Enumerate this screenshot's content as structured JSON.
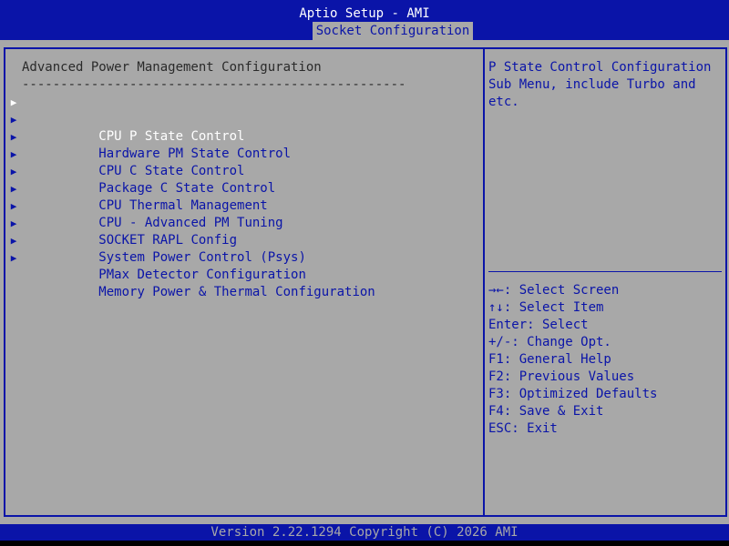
{
  "header": {
    "app_title": "Aptio Setup - AMI",
    "active_tab": "Socket Configuration"
  },
  "main": {
    "section_title": "Advanced Power Management Configuration",
    "divider": "--------------------------------------------------",
    "submenu_marker": "▶",
    "selected_index": 0,
    "items": [
      {
        "label": "CPU P State Control"
      },
      {
        "label": "Hardware PM State Control"
      },
      {
        "label": "CPU C State Control"
      },
      {
        "label": "Package C State Control"
      },
      {
        "label": "CPU Thermal Management"
      },
      {
        "label": "CPU - Advanced PM Tuning"
      },
      {
        "label": "SOCKET RAPL Config"
      },
      {
        "label": "System Power Control (Psys)"
      },
      {
        "label": "PMax Detector Configuration"
      },
      {
        "label": "Memory Power & Thermal Configuration"
      }
    ]
  },
  "help": {
    "text": "P State Control Configuration Sub Menu, include Turbo and etc.",
    "keys": [
      "→←: Select Screen",
      "↑↓: Select Item",
      "Enter: Select",
      "+/-: Change Opt.",
      "F1: General Help",
      "F2: Previous Values",
      "F3: Optimized Defaults",
      "F4: Save & Exit",
      "ESC: Exit"
    ]
  },
  "footer": {
    "text": "Version 2.22.1294 Copyright (C) 2026 AMI"
  },
  "colors": {
    "blue": "#0a14a8",
    "gray": "#a8a8a8",
    "white": "#ffffff",
    "dark_text": "#2a2a2a"
  }
}
